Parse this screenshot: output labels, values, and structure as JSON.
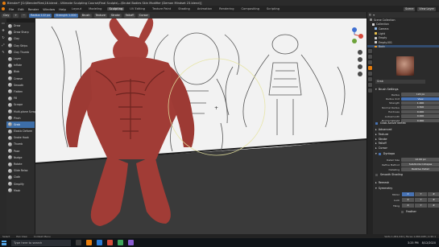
{
  "window": {
    "title": "Blender* [G:\\BlenderFiles\\16.blend - Ultimate Sculpting Course\\Final Sculpts\\...\\Brutal Bodies Skin Modifier (Demon Mindset 23.blend)]"
  },
  "menubar": {
    "menus": [
      "File",
      "Edit",
      "Render",
      "Window",
      "Help"
    ],
    "workspaces": [
      "Layout",
      "Modeling",
      "Sculpting",
      "UV Editing",
      "Texture Paint",
      "Shading",
      "Animation",
      "Rendering",
      "Compositing",
      "Scripting"
    ],
    "active_workspace": "Sculpting",
    "scene": "Scene",
    "view_layer": "View Layer"
  },
  "tool_header": {
    "brush": "Clay",
    "radius": "Radius 122 px",
    "strength": "Strength 1.000",
    "add": "+",
    "subtract": "−",
    "brush_menu": "Brush",
    "texture": "Texture",
    "stroke": "Stroke",
    "falloff": "Falloff",
    "cursor": "Cursor"
  },
  "brushes": [
    "Draw",
    "Draw Sharp",
    "Clay",
    "Clay Strips",
    "Clay Thumb",
    "Layer",
    "Inflate",
    "Blob",
    "Crease",
    "Smooth",
    "Flatten",
    "Fill",
    "Scrape",
    "Multi-plane Scrape",
    "Pinch",
    "Grab",
    "Elastic Deform",
    "Snake Hook",
    "Thumb",
    "Pose",
    "Nudge",
    "Rotate",
    "Slide Relax",
    "Cloth",
    "Simplify",
    "Mask"
  ],
  "selected_brush": "Grab",
  "outliner": {
    "rows": [
      {
        "label": "Scene Collection",
        "color": "#8c8c8c"
      },
      {
        "label": "Collection",
        "color": "#d9d9d9"
      },
      {
        "label": "Camera",
        "color": "#8fb8e6"
      },
      {
        "label": "Light",
        "color": "#e8c04c"
      },
      {
        "label": "Empty",
        "color": "#cfcfcf"
      },
      {
        "label": "Empty.001",
        "color": "#cfcfcf"
      },
      {
        "label": "Body",
        "color": "#f0a030"
      }
    ],
    "selected_row": 6
  },
  "properties": {
    "brush_name": "Grab",
    "brush_settings_title": "Brush Settings",
    "rows": [
      {
        "label": "Radius",
        "value": "122 px"
      },
      {
        "label": "Radius Unit",
        "value": "View"
      },
      {
        "label": "Strength",
        "value": "1.000"
      },
      {
        "label": "Normal Radius",
        "value": "0.500"
      },
      {
        "label": "Hardness",
        "value": "0.000"
      },
      {
        "label": "Autosmooth",
        "value": "0.000"
      },
      {
        "label": "Normal Weight",
        "value": "0.000"
      }
    ],
    "checkbox_label": "Grab Active Vertex",
    "sections": [
      "Advanced",
      "Texture",
      "Stroke",
      "Falloff",
      "Cursor"
    ],
    "dyntopo_title": "Dyntopo",
    "dyntopo_rows": [
      {
        "label": "Detail Size",
        "value": "12.00 px"
      },
      {
        "label": "Refine Method",
        "value": "Subdivide Collapse"
      },
      {
        "label": "Detailing",
        "value": "Relative Detail"
      }
    ],
    "smooth_shading": "Smooth Shading",
    "remesh": "Remesh",
    "symmetry_title": "Symmetry",
    "mirror_label": "Mirror",
    "lock_label": "Lock",
    "tiling_label": "Tiling",
    "axes": [
      "X",
      "Y",
      "Z"
    ],
    "feather_label": "Feather"
  },
  "statusbar": {
    "left": "Select",
    "middle": "Pan View",
    "right": "Context Menu",
    "version": "Verts 1,061,044 | Faces 1,060,948 | 2.90.1"
  },
  "taskbar": {
    "search_placeholder": "Type here to search",
    "time": "3:25 PM",
    "date": "8/12/2020"
  },
  "colors": {
    "accent": "#e87d0d",
    "selection": "#4772b3",
    "sculpt": "#a6403a"
  }
}
